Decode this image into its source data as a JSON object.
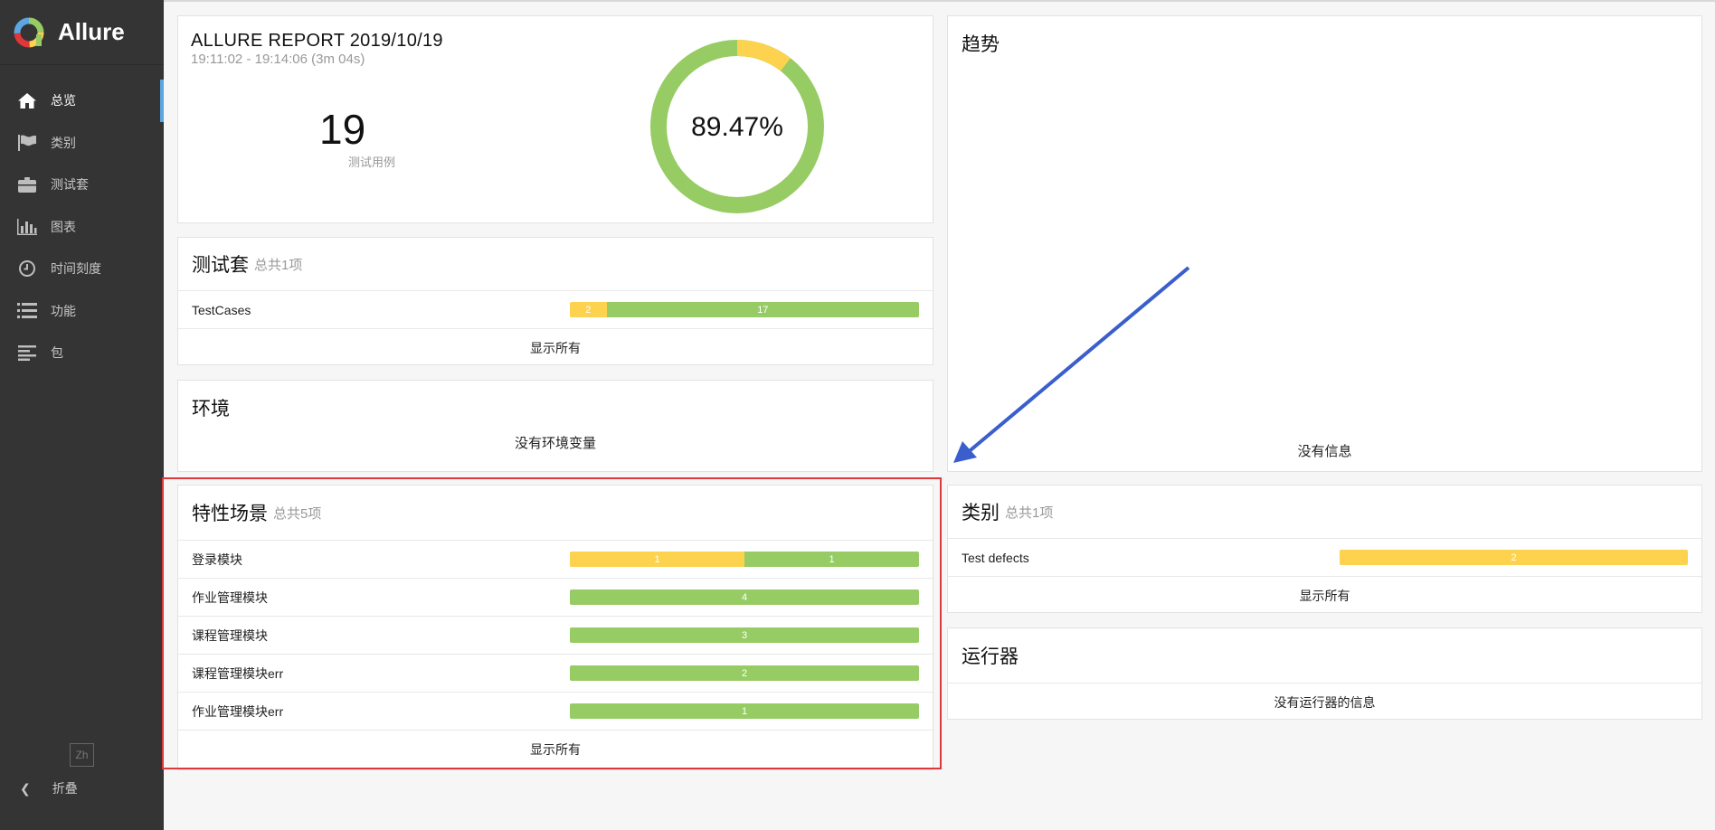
{
  "app": {
    "name": "Allure"
  },
  "sidebar": {
    "items": [
      {
        "label": "总览",
        "icon": "home-icon",
        "active": true
      },
      {
        "label": "类别",
        "icon": "flag-icon",
        "active": false
      },
      {
        "label": "测试套",
        "icon": "briefcase-icon",
        "active": false
      },
      {
        "label": "图表",
        "icon": "bar-chart-icon",
        "active": false
      },
      {
        "label": "时间刻度",
        "icon": "clock-icon",
        "active": false
      },
      {
        "label": "功能",
        "icon": "list-icon",
        "active": false
      },
      {
        "label": "包",
        "icon": "align-left-icon",
        "active": false
      }
    ],
    "lang": "Zh",
    "collapse_label": "折叠"
  },
  "summary": {
    "title": "ALLURE REPORT 2019/10/19",
    "time": "19:11:02 - 19:14:06 (3m 04s)",
    "count": "19",
    "count_label": "测试用例",
    "percent": "89.47%",
    "passed": 17,
    "broken": 2
  },
  "suites": {
    "title": "测试套",
    "subtitle": "总共1项",
    "rows": [
      {
        "name": "TestCases",
        "broken": "2",
        "passed": "17"
      }
    ],
    "footer": "显示所有"
  },
  "environment": {
    "title": "环境",
    "empty": "没有环境变量"
  },
  "features": {
    "title": "特性场景",
    "subtitle": "总共5项",
    "rows": [
      {
        "name": "登录模块",
        "broken": "1",
        "passed": "1"
      },
      {
        "name": "作业管理模块",
        "broken": "",
        "passed": "4"
      },
      {
        "name": "课程管理模块",
        "broken": "",
        "passed": "3"
      },
      {
        "name": "课程管理模块err",
        "broken": "",
        "passed": "2"
      },
      {
        "name": "作业管理模块err",
        "broken": "",
        "passed": "1"
      }
    ],
    "footer": "显示所有"
  },
  "trend": {
    "title": "趋势",
    "empty": "没有信息"
  },
  "categories": {
    "title": "类别",
    "subtitle": "总共1项",
    "rows": [
      {
        "name": "Test defects",
        "broken": "2"
      }
    ],
    "footer": "显示所有"
  },
  "executors": {
    "title": "运行器",
    "empty": "没有运行器的信息"
  },
  "colors": {
    "passed": "#97cc64",
    "broken": "#fdd24f",
    "sidebar": "#343434",
    "accent": "#5ca7e0",
    "highlight": "#e0373a",
    "arrow": "#3a5fcd"
  }
}
